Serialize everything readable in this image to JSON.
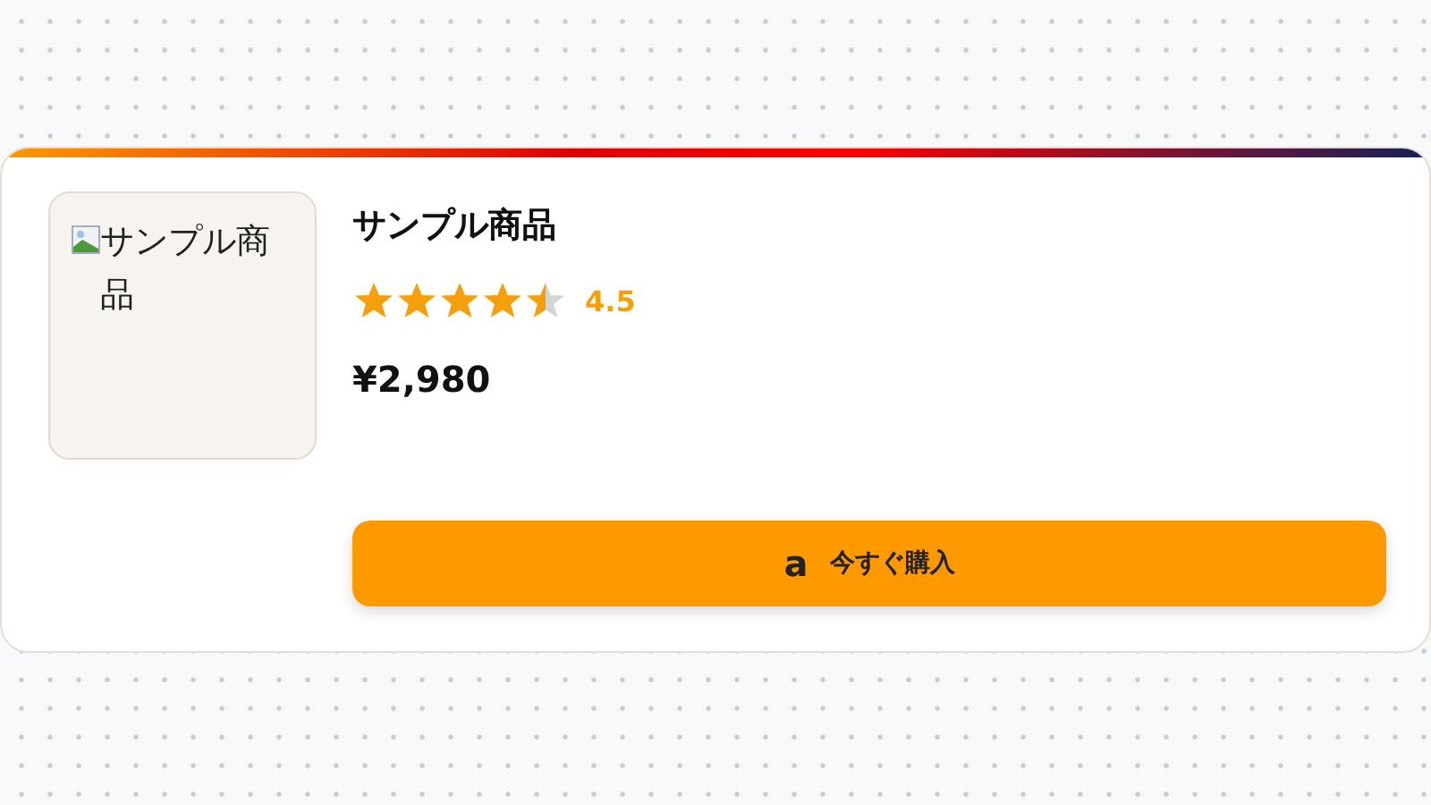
{
  "product": {
    "image": {
      "kind": "picture",
      "alt": "サンプル商品"
    },
    "title": "サンプル商品",
    "rating": {
      "stars": 4.5,
      "value": "4.5"
    },
    "price": "¥2,980",
    "buy_button": {
      "icon": "a",
      "label": "今すぐ購入"
    }
  }
}
